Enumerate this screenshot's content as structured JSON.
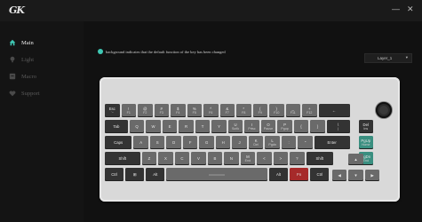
{
  "app": {
    "logo": "GK"
  },
  "window": {
    "minimize": "—",
    "close": "✕"
  },
  "sidebar": {
    "items": [
      {
        "label": "Main",
        "icon": "home-icon",
        "active": true
      },
      {
        "label": "Light",
        "icon": "bulb-icon",
        "active": false
      },
      {
        "label": "Macro",
        "icon": "macro-icon",
        "active": false
      },
      {
        "label": "Support",
        "icon": "heart-icon",
        "active": false
      }
    ]
  },
  "main": {
    "hint": "background indicates that the default function of the key has been changed",
    "layer": "Layer_1"
  },
  "keyboard": {
    "rows": [
      [
        [
          "Esc",
          "`~"
        ],
        [
          "!",
          "F1"
        ],
        [
          "@",
          "F2"
        ],
        [
          "#",
          "F3"
        ],
        [
          "$",
          "F4"
        ],
        [
          "%",
          "F5"
        ],
        [
          "^",
          "F6"
        ],
        [
          "&",
          "F7"
        ],
        [
          "*",
          "F8"
        ],
        [
          "(",
          "F9"
        ],
        [
          ")",
          "F10"
        ],
        [
          "_",
          "F11"
        ],
        [
          "+",
          "F12"
        ],
        [
          "←",
          ""
        ]
      ],
      [
        [
          "Tab",
          ""
        ],
        [
          "Q",
          ""
        ],
        [
          "W",
          ""
        ],
        [
          "E",
          ""
        ],
        [
          "R",
          ""
        ],
        [
          "T",
          ""
        ],
        [
          "Y",
          ""
        ],
        [
          "U",
          "Scrlk"
        ],
        [
          "I",
          "Prtsc"
        ],
        [
          "O",
          "Pause"
        ],
        [
          "P",
          "Pgup"
        ],
        [
          "{",
          ""
        ],
        [
          "}",
          ""
        ],
        [
          "\\",
          "|"
        ]
      ],
      [
        [
          "Caps",
          ""
        ],
        [
          "A",
          ""
        ],
        [
          "S",
          ""
        ],
        [
          "D",
          ""
        ],
        [
          "F",
          ""
        ],
        [
          "G",
          ""
        ],
        [
          "H",
          ""
        ],
        [
          "J",
          ""
        ],
        [
          "K",
          "Del"
        ],
        [
          "L",
          "Pgdn"
        ],
        [
          ":",
          ""
        ],
        [
          "\"",
          ""
        ],
        [
          "Enter",
          ""
        ]
      ],
      [
        [
          "Shift",
          ""
        ],
        [
          "Z",
          ""
        ],
        [
          "X",
          ""
        ],
        [
          "C",
          ""
        ],
        [
          "V",
          ""
        ],
        [
          "B",
          ""
        ],
        [
          "N",
          ""
        ],
        [
          "M",
          "End"
        ],
        [
          "<",
          ""
        ],
        [
          ">",
          ""
        ],
        [
          "?",
          ""
        ],
        [
          "Shift",
          ""
        ]
      ],
      [
        [
          "Ctrl",
          ""
        ],
        [
          "⊞",
          ""
        ],
        [
          "Alt",
          ""
        ],
        [
          "",
          ""
        ],
        [
          "Alt",
          ""
        ],
        [
          "Fn",
          ""
        ],
        [
          "Ctrl",
          ""
        ]
      ]
    ],
    "side": [
      [
        "Del",
        "Ins"
      ],
      [
        "PgUp",
        "Home"
      ],
      [
        "PgDn",
        "End"
      ]
    ],
    "arrows": {
      "up": "▲",
      "left": "◀",
      "down": "▼",
      "right": "▶"
    }
  },
  "colors": {
    "changed": "#3a8f80",
    "fn_key": "#a62a2a",
    "accent": "#3fc8b4"
  }
}
